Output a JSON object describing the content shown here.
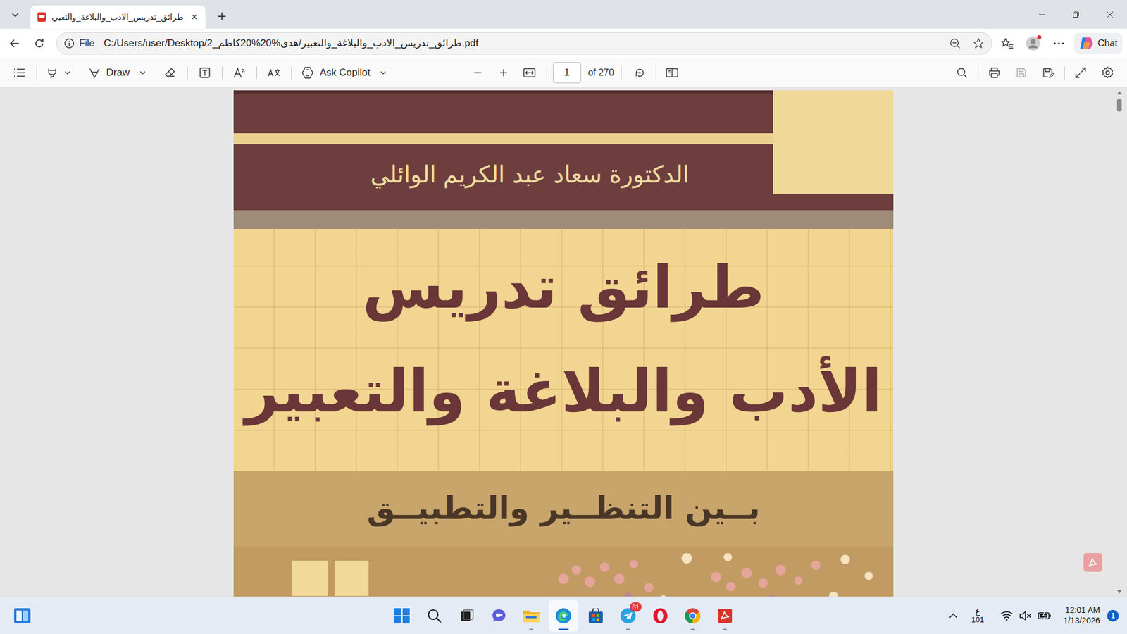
{
  "tabs": [
    {
      "label": "طرائق_تدريس_الادب_والبلاغة_والتعبي",
      "selected": true,
      "close": "×"
    }
  ],
  "new_tab": "+",
  "address_bar": {
    "scheme": "File",
    "url": "C:/Users/user/Desktop/2_طرائق_تدريس_الادب_والبلاغة_والتعبير/هدى%20%20كاظم.pdf"
  },
  "chat_button": "Chat",
  "pdf_toolbar": {
    "draw": "Draw",
    "ask_copilot": "Ask Copilot",
    "page": "1",
    "page_count": "of 270",
    "save_disabled": true
  },
  "document": {
    "author": "الدكتورة سعاد عبد الكريم الوائلي",
    "title_lines": [
      "طرائق تدريس",
      "الأدب والبلاغة والتعبير"
    ],
    "subtitle": "بــين التنظــير والتطبيــق"
  },
  "taskbar": {
    "apps": [
      {
        "running": false,
        "active": false
      },
      {
        "running": false,
        "active": false
      },
      {
        "running": false,
        "active": false
      },
      {
        "running": false,
        "active": false
      },
      {
        "running": true,
        "active": false
      },
      {
        "running": true,
        "active": true
      },
      {
        "running": false,
        "active": false
      },
      {
        "running": true,
        "active": false
      },
      {
        "running": false,
        "active": false
      },
      {
        "running": true,
        "active": false
      },
      {
        "running": true,
        "active": false
      }
    ],
    "telegram_badge": "81",
    "input_language": "ع",
    "input_code": "101",
    "time": "12:01 AM",
    "date": "1/13/2026",
    "notifications": "1"
  }
}
